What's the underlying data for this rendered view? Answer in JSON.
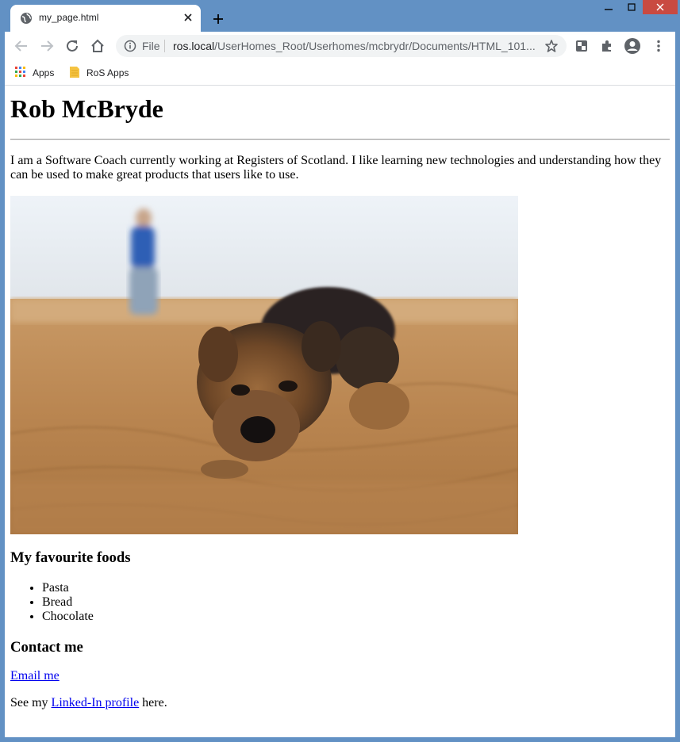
{
  "browser": {
    "tab_title": "my_page.html",
    "omnibox": {
      "scheme_label": "File",
      "host": "ros.local",
      "path": "/UserHomes_Root/Userhomes/mcbrydr/Documents/HTML_101..."
    },
    "bookmarks": [
      {
        "label": "Apps",
        "icon": "apps-grid-icon"
      },
      {
        "label": "RoS Apps",
        "icon": "folder-icon"
      }
    ],
    "colors": {
      "frame": "#6291c4",
      "close": "#c94a41"
    }
  },
  "page": {
    "heading": "Rob McBryde",
    "intro": "I am a Software Coach currently working at Registers of Scotland. I like learning new technologies and understanding how they can be used to make great products that users like to use.",
    "photo_alt": "",
    "foods_heading": "My favourite foods",
    "foods": [
      "Pasta",
      "Bread",
      "Chocolate"
    ],
    "contact_heading": "Contact me",
    "email_link": "Email me",
    "linkedin_prefix": "See my ",
    "linkedin_link": "Linked-In profile",
    "linkedin_suffix": " here."
  }
}
